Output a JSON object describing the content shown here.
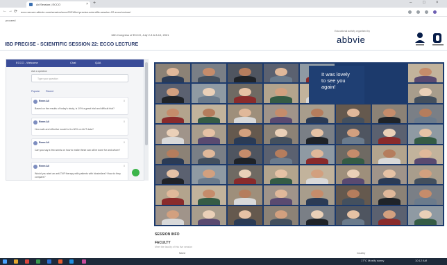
{
  "browser": {
    "tab_title": "Ad Session | ECCO",
    "tab_close": "×",
    "new_tab": "+",
    "window_controls": [
      "–",
      "□",
      "×"
    ],
    "nav": [
      "←",
      "→",
      "⟳"
    ],
    "url": "ecco.secure.abbvie.com/session/ecco2021/ibd-precise-scientific-session-22-ecco-lecture/",
    "bookmark": "proceed"
  },
  "header": {
    "congress": "16th Congress of ECCO, July 2-3 & 8-10, 2021",
    "title": "IBD PRECISE - SCIENTIFIC SESSION 22: ECCO LECTURE",
    "sponsor_note": "Educational activity organised by",
    "logo_text": "abbvie"
  },
  "chat": {
    "panel_tabs": [
      "ECCO - Welcome",
      "Chat",
      "Q&A"
    ],
    "compose_label": "Ask a question",
    "compose_placeholder": "Type your question",
    "list_tabs": [
      "Popular",
      "Recent"
    ],
    "messages": [
      {
        "name": "Reem Ali",
        "text": "Based on the results of today's study, is 10% a great trial and difficult trial?",
        "likes": "0"
      },
      {
        "name": "Reem Ali",
        "text": "How safe and effective would is it a 60% on AUT data?",
        "likes": "0"
      },
      {
        "name": "Reem Ali",
        "text": "Can you say a few words on how to make these can all be done for and whom?",
        "likes": "0"
      },
      {
        "name": "Reem Ali",
        "text": "Would you start an anti-TNF therapy with patients with biosimilars? How do they compare?",
        "likes": "0"
      }
    ]
  },
  "video": {
    "overlay_text": "It was lovely\nto see you\nagain!"
  },
  "session": {
    "info_label": "SESSION INFO",
    "faculty_label": "FACULTY",
    "faculty_sub": "Meet the faculty of this live session",
    "columns": [
      "Name",
      "Country"
    ]
  },
  "taskbar": {
    "tray_text": "17°C Mostly sunny",
    "clock": "10:12 AM"
  },
  "colors": {
    "accent": "#3a4c98",
    "brand": "#071d49",
    "video_bg": "#1c3a6c",
    "fab": "#3cb54a"
  }
}
